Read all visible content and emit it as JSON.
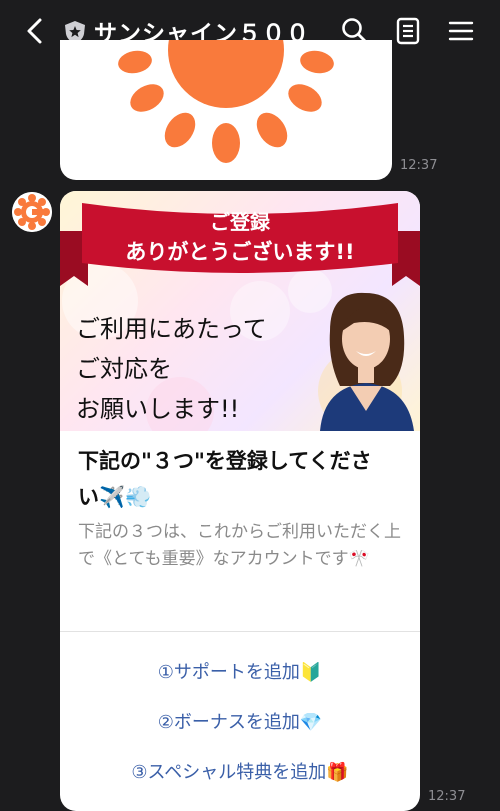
{
  "header": {
    "title": "サンシャイン５００",
    "back_icon": "chevron-left-icon",
    "official_icon": "shield-icon",
    "search_icon": "search-icon",
    "notes_icon": "notes-icon",
    "menu_icon": "menu-icon"
  },
  "messages": [
    {
      "type": "image",
      "timestamp": "12:37"
    },
    {
      "type": "card",
      "timestamp": "12:37",
      "banner": {
        "ribbon_line1": "ご登録",
        "ribbon_line2": "ありがとうございます!!",
        "body_line1": "ご利用にあたって",
        "body_line2": "ご対応を",
        "body_line3": "お願いします!!"
      },
      "title_line1": "下記の\"３つ\"を登録してくださ",
      "title_line2": "い✈️💨",
      "description": "下記の３つは、これからご利用いただく上で《とても重要》なアカウントです🎌",
      "actions": [
        {
          "label": "①サポートを追加🔰"
        },
        {
          "label": "②ボーナスを追加💎"
        },
        {
          "label": "③スペシャル特典を追加🎁"
        }
      ]
    }
  ],
  "colors": {
    "background": "#1c1c1e",
    "ribbon": "#c8102e",
    "sun": "#f97a3c",
    "link": "#3a5fa8"
  }
}
